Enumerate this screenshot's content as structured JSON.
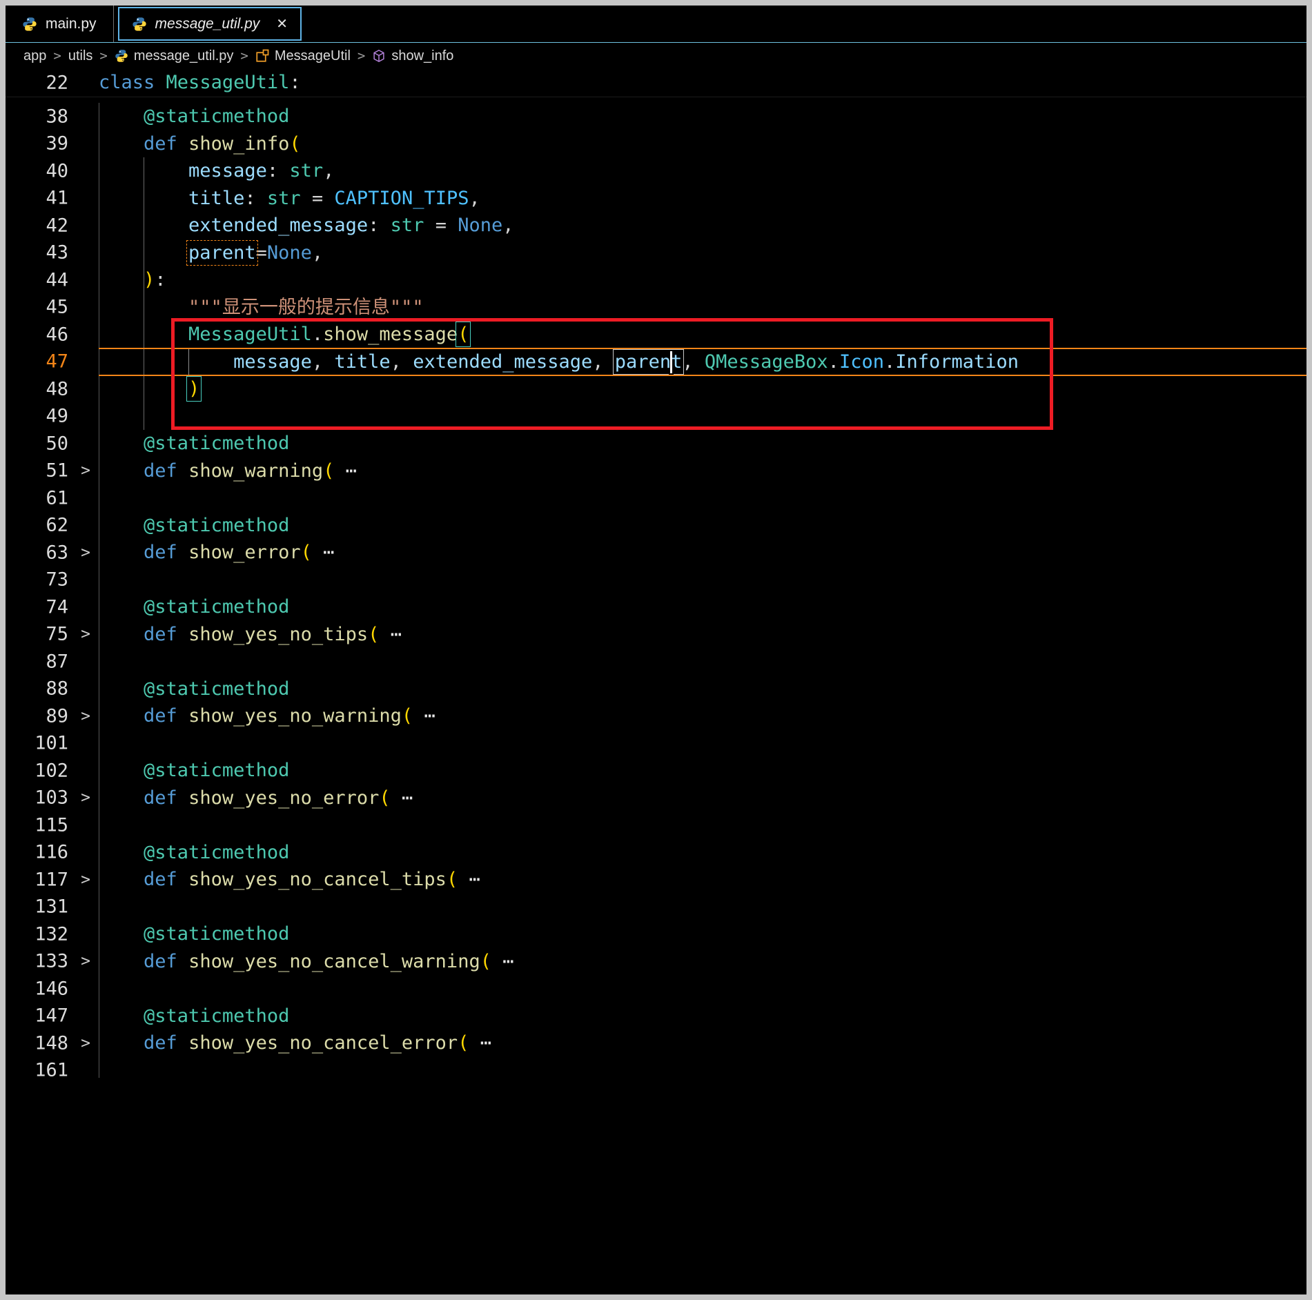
{
  "colors": {
    "accent_orange": "#f38518",
    "annotation_red": "#ed1c24",
    "keyword_blue": "#569cd6",
    "type_teal": "#4ec9b0",
    "function_yellow": "#dcdcaa",
    "variable_blue": "#9cdcfe",
    "constant_cyan": "#4fc1ff",
    "string_brown": "#ce9178",
    "bracket_gold": "#ffd700",
    "tab_border_blue": "#5fb4e8"
  },
  "tabs": {
    "close_glyph": "✕",
    "items": [
      {
        "label": "main.py",
        "active": false
      },
      {
        "label": "message_util.py",
        "active": true
      }
    ]
  },
  "breadcrumb": {
    "separator": ">",
    "items": [
      {
        "label": "app"
      },
      {
        "label": "utils"
      },
      {
        "label": "message_util.py",
        "icon": "python-icon"
      },
      {
        "label": "MessageUtil",
        "icon": "class-icon"
      },
      {
        "label": "show_info",
        "icon": "method-icon"
      }
    ]
  },
  "sticky": {
    "num": "22",
    "tokens": [
      {
        "t": "class ",
        "c": "kw"
      },
      {
        "t": "MessageUtil",
        "c": "typ"
      },
      {
        "t": ":",
        "c": "pun"
      }
    ]
  },
  "code": {
    "fold_chevron": ">",
    "guides": [
      {
        "col": 0,
        "from": 0,
        "to": 35,
        "cls": "g0"
      },
      {
        "col": 4,
        "from": 2,
        "to": 11,
        "cls": "g4"
      },
      {
        "col": 8,
        "from": 9,
        "to": 9,
        "cls": "g8"
      }
    ],
    "lines": [
      {
        "n": "38",
        "tokens": [
          {
            "t": "    "
          },
          {
            "t": "@staticmethod",
            "c": "deco"
          }
        ]
      },
      {
        "n": "39",
        "tokens": [
          {
            "t": "    "
          },
          {
            "t": "def ",
            "c": "kw"
          },
          {
            "t": "show_info",
            "c": "fn"
          },
          {
            "t": "(",
            "c": "brk"
          }
        ]
      },
      {
        "n": "40",
        "tokens": [
          {
            "t": "        "
          },
          {
            "t": "message",
            "c": "var"
          },
          {
            "t": ": ",
            "c": "pun"
          },
          {
            "t": "str",
            "c": "typ"
          },
          {
            "t": ",",
            "c": "pun"
          }
        ]
      },
      {
        "n": "41",
        "tokens": [
          {
            "t": "        "
          },
          {
            "t": "title",
            "c": "var"
          },
          {
            "t": ": ",
            "c": "pun"
          },
          {
            "t": "str",
            "c": "typ"
          },
          {
            "t": " = ",
            "c": "pun"
          },
          {
            "t": "CAPTION_TIPS",
            "c": "const"
          },
          {
            "t": ",",
            "c": "pun"
          }
        ]
      },
      {
        "n": "42",
        "tokens": [
          {
            "t": "        "
          },
          {
            "t": "extended_message",
            "c": "var"
          },
          {
            "t": ": ",
            "c": "pun"
          },
          {
            "t": "str",
            "c": "typ"
          },
          {
            "t": " = ",
            "c": "pun"
          },
          {
            "t": "None",
            "c": "kw"
          },
          {
            "t": ",",
            "c": "pun"
          }
        ]
      },
      {
        "n": "43",
        "tokens": [
          {
            "t": "        "
          },
          {
            "box": "occ",
            "tokens": [
              {
                "t": "parent",
                "c": "var"
              }
            ]
          },
          {
            "t": "=",
            "c": "pun"
          },
          {
            "t": "None",
            "c": "kw"
          },
          {
            "t": ",",
            "c": "pun"
          }
        ]
      },
      {
        "n": "44",
        "tokens": [
          {
            "t": "    "
          },
          {
            "t": ")",
            "c": "brk"
          },
          {
            "t": ":",
            "c": "pun"
          }
        ]
      },
      {
        "n": "45",
        "tokens": [
          {
            "t": "        "
          },
          {
            "t": "\"\"\"显示一般的提示信息\"\"\"",
            "c": "str"
          }
        ]
      },
      {
        "n": "46",
        "tokens": [
          {
            "t": "        "
          },
          {
            "t": "MessageUtil",
            "c": "typ"
          },
          {
            "t": ".",
            "c": "pun"
          },
          {
            "t": "show_message",
            "c": "fn"
          },
          {
            "box": "brkm",
            "tokens": [
              {
                "t": "(",
                "c": "brk"
              }
            ]
          }
        ]
      },
      {
        "n": "47",
        "cur": true,
        "tokens": [
          {
            "t": "            "
          },
          {
            "t": "message",
            "c": "var"
          },
          {
            "t": ", ",
            "c": "pun"
          },
          {
            "t": "title",
            "c": "var"
          },
          {
            "t": ", ",
            "c": "pun"
          },
          {
            "t": "extended_message",
            "c": "var"
          },
          {
            "t": ", ",
            "c": "pun"
          },
          {
            "box": "occ2",
            "tokens": [
              {
                "t": "paren",
                "c": "var"
              },
              {
                "cursor": true
              },
              {
                "t": "t",
                "c": "var"
              }
            ]
          },
          {
            "t": ", ",
            "c": "pun"
          },
          {
            "t": "QMessageBox",
            "c": "typ"
          },
          {
            "t": ".",
            "c": "pun"
          },
          {
            "t": "Icon",
            "c": "const"
          },
          {
            "t": ".",
            "c": "pun"
          },
          {
            "t": "Information",
            "c": "var"
          }
        ]
      },
      {
        "n": "48",
        "tokens": [
          {
            "t": "        "
          },
          {
            "box": "brkm",
            "tokens": [
              {
                "t": ")",
                "c": "brk"
              }
            ]
          }
        ]
      },
      {
        "n": "49",
        "tokens": []
      },
      {
        "n": "50",
        "tokens": [
          {
            "t": "    "
          },
          {
            "t": "@staticmethod",
            "c": "deco"
          }
        ]
      },
      {
        "n": "51",
        "fold": true,
        "tokens": [
          {
            "t": "    "
          },
          {
            "t": "def ",
            "c": "kw"
          },
          {
            "t": "show_warning",
            "c": "fn"
          },
          {
            "t": "(",
            "c": "brk"
          },
          {
            "t": " "
          },
          {
            "t": "⋯",
            "c": "fold"
          }
        ]
      },
      {
        "n": "61",
        "tokens": []
      },
      {
        "n": "62",
        "tokens": [
          {
            "t": "    "
          },
          {
            "t": "@staticmethod",
            "c": "deco"
          }
        ]
      },
      {
        "n": "63",
        "fold": true,
        "tokens": [
          {
            "t": "    "
          },
          {
            "t": "def ",
            "c": "kw"
          },
          {
            "t": "show_error",
            "c": "fn"
          },
          {
            "t": "(",
            "c": "brk"
          },
          {
            "t": " "
          },
          {
            "t": "⋯",
            "c": "fold"
          }
        ]
      },
      {
        "n": "73",
        "tokens": []
      },
      {
        "n": "74",
        "tokens": [
          {
            "t": "    "
          },
          {
            "t": "@staticmethod",
            "c": "deco"
          }
        ]
      },
      {
        "n": "75",
        "fold": true,
        "tokens": [
          {
            "t": "    "
          },
          {
            "t": "def ",
            "c": "kw"
          },
          {
            "t": "show_yes_no_tips",
            "c": "fn"
          },
          {
            "t": "(",
            "c": "brk"
          },
          {
            "t": " "
          },
          {
            "t": "⋯",
            "c": "fold"
          }
        ]
      },
      {
        "n": "87",
        "tokens": []
      },
      {
        "n": "88",
        "tokens": [
          {
            "t": "    "
          },
          {
            "t": "@staticmethod",
            "c": "deco"
          }
        ]
      },
      {
        "n": "89",
        "fold": true,
        "tokens": [
          {
            "t": "    "
          },
          {
            "t": "def ",
            "c": "kw"
          },
          {
            "t": "show_yes_no_warning",
            "c": "fn"
          },
          {
            "t": "(",
            "c": "brk"
          },
          {
            "t": " "
          },
          {
            "t": "⋯",
            "c": "fold"
          }
        ]
      },
      {
        "n": "101",
        "tokens": []
      },
      {
        "n": "102",
        "tokens": [
          {
            "t": "    "
          },
          {
            "t": "@staticmethod",
            "c": "deco"
          }
        ]
      },
      {
        "n": "103",
        "fold": true,
        "tokens": [
          {
            "t": "    "
          },
          {
            "t": "def ",
            "c": "kw"
          },
          {
            "t": "show_yes_no_error",
            "c": "fn"
          },
          {
            "t": "(",
            "c": "brk"
          },
          {
            "t": " "
          },
          {
            "t": "⋯",
            "c": "fold"
          }
        ]
      },
      {
        "n": "115",
        "tokens": []
      },
      {
        "n": "116",
        "tokens": [
          {
            "t": "    "
          },
          {
            "t": "@staticmethod",
            "c": "deco"
          }
        ]
      },
      {
        "n": "117",
        "fold": true,
        "tokens": [
          {
            "t": "    "
          },
          {
            "t": "def ",
            "c": "kw"
          },
          {
            "t": "show_yes_no_cancel_tips",
            "c": "fn"
          },
          {
            "t": "(",
            "c": "brk"
          },
          {
            "t": " "
          },
          {
            "t": "⋯",
            "c": "fold"
          }
        ]
      },
      {
        "n": "131",
        "tokens": []
      },
      {
        "n": "132",
        "tokens": [
          {
            "t": "    "
          },
          {
            "t": "@staticmethod",
            "c": "deco"
          }
        ]
      },
      {
        "n": "133",
        "fold": true,
        "tokens": [
          {
            "t": "    "
          },
          {
            "t": "def ",
            "c": "kw"
          },
          {
            "t": "show_yes_no_cancel_warning",
            "c": "fn"
          },
          {
            "t": "(",
            "c": "brk"
          },
          {
            "t": " "
          },
          {
            "t": "⋯",
            "c": "fold"
          }
        ]
      },
      {
        "n": "146",
        "tokens": []
      },
      {
        "n": "147",
        "tokens": [
          {
            "t": "    "
          },
          {
            "t": "@staticmethod",
            "c": "deco"
          }
        ]
      },
      {
        "n": "148",
        "fold": true,
        "tokens": [
          {
            "t": "    "
          },
          {
            "t": "def ",
            "c": "kw"
          },
          {
            "t": "show_yes_no_cancel_error",
            "c": "fn"
          },
          {
            "t": "(",
            "c": "brk"
          },
          {
            "t": " "
          },
          {
            "t": "⋯",
            "c": "fold"
          }
        ]
      },
      {
        "n": "161",
        "tokens": []
      }
    ]
  }
}
